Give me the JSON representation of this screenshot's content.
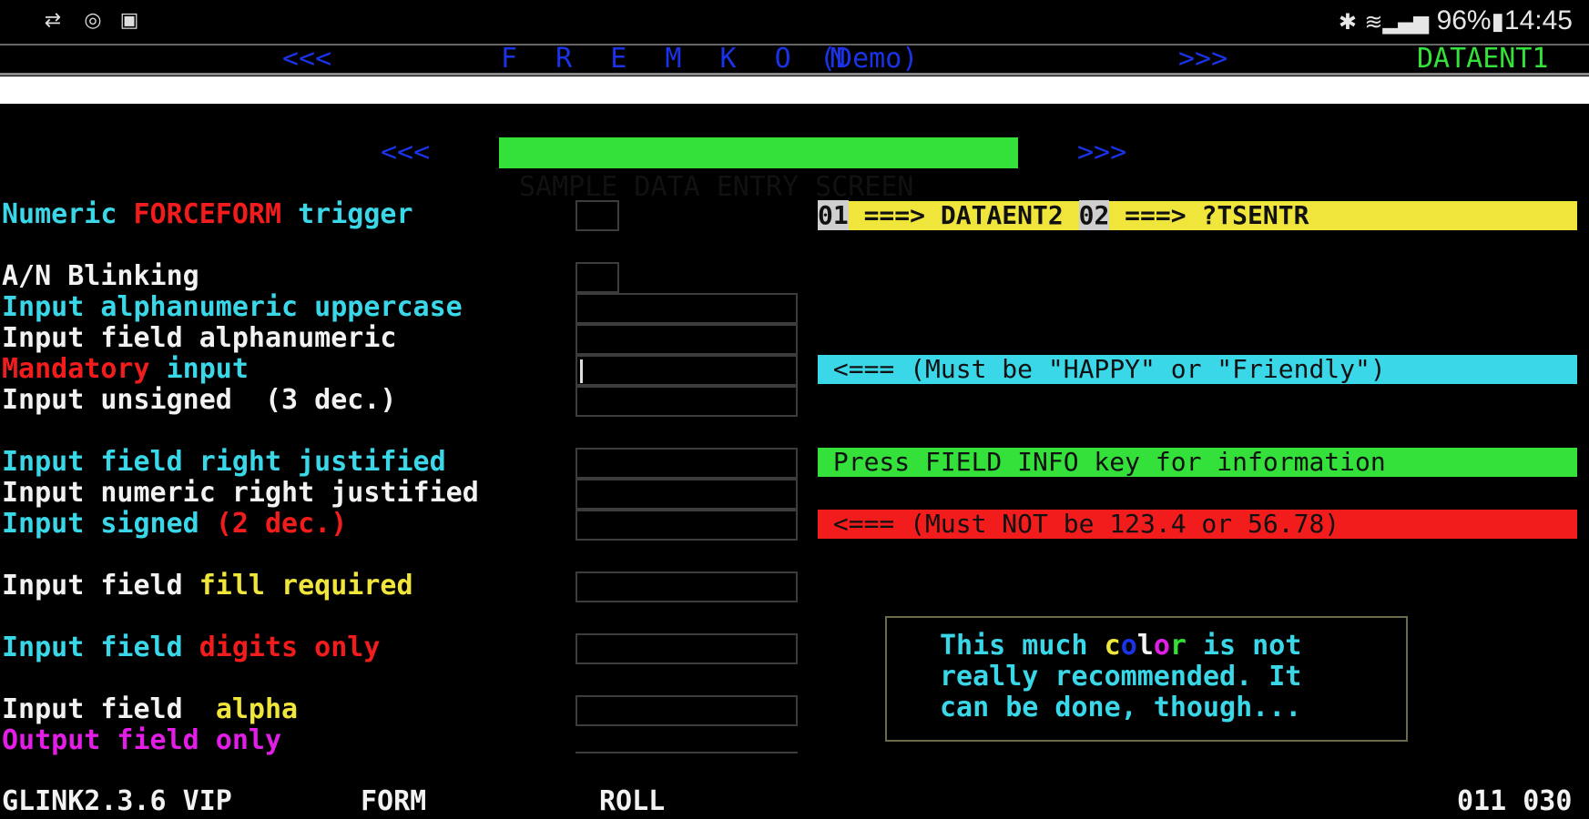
{
  "status_bar": {
    "battery": "96%",
    "time": "14:45",
    "icons_left": [
      "transfer-icon",
      "sync-icon",
      "screenshot-icon"
    ],
    "icons_right": [
      "bluetooth-icon",
      "wifi-icon",
      "signal-icon",
      "battery-icon"
    ]
  },
  "header": {
    "left_arrows": "<<<",
    "title": "F R E M K O N",
    "mode": "(Demo)",
    "right_arrows": ">>>",
    "screen_id": "DATAENT1"
  },
  "screen_title": {
    "left_arrows": "<<<",
    "text": "SAMPLE DATA ENTRY SCREEN",
    "right_arrows": ">>>"
  },
  "labels": {
    "forceform_1": "Numeric ",
    "forceform_2": "FORCEFORM",
    "forceform_3": " trigger",
    "blinking": "A/N Blinking",
    "upper": "Input alphanumeric uppercase",
    "alnum": "Input field alphanumeric",
    "mandatory_1": "Mandatory",
    "mandatory_2": " input",
    "unsigned": "Input unsigned  (3 dec.)",
    "right_just": "Input field right justified",
    "num_right_just": "Input numeric right justified",
    "signed_1": "Input signed ",
    "signed_2": "(2 dec.)",
    "fill_1": "Input field ",
    "fill_2": "fill required",
    "digits_1": "Input field ",
    "digits_2": "digits only",
    "alpha_1": "Input field  ",
    "alpha_2": "alpha",
    "output": "Output field only"
  },
  "banners": {
    "nav_01": "01",
    "nav_01_target": " ===> DATAENT2 ",
    "nav_02": "02",
    "nav_02_target": " ===> ?TSENTR",
    "happy": " <=== (Must be \"HAPPY\" or \"Friendly\")",
    "field_info": " Press FIELD INFO key for information",
    "not_value": " <=== (Must NOT be 123.4 or 56.78)"
  },
  "note": {
    "line1_a": "This much ",
    "color_c": "c",
    "color_o": "o",
    "color_l": "l",
    "color_o2": "o",
    "color_r": "r",
    "line1_b": " is not",
    "line2": "really recommended. It",
    "line3": "can be done, though..."
  },
  "footer": {
    "version": "GLINK2.3.6 VIP",
    "mode": "FORM",
    "scroll": "ROLL",
    "cursor_pos": "011 030"
  },
  "colors": {
    "cyan": "#3ad7e8",
    "red": "#f21c1c",
    "yellow": "#f0e53a",
    "green": "#34e03a",
    "magenta": "#e21ee6",
    "blue": "#1b33e8"
  }
}
